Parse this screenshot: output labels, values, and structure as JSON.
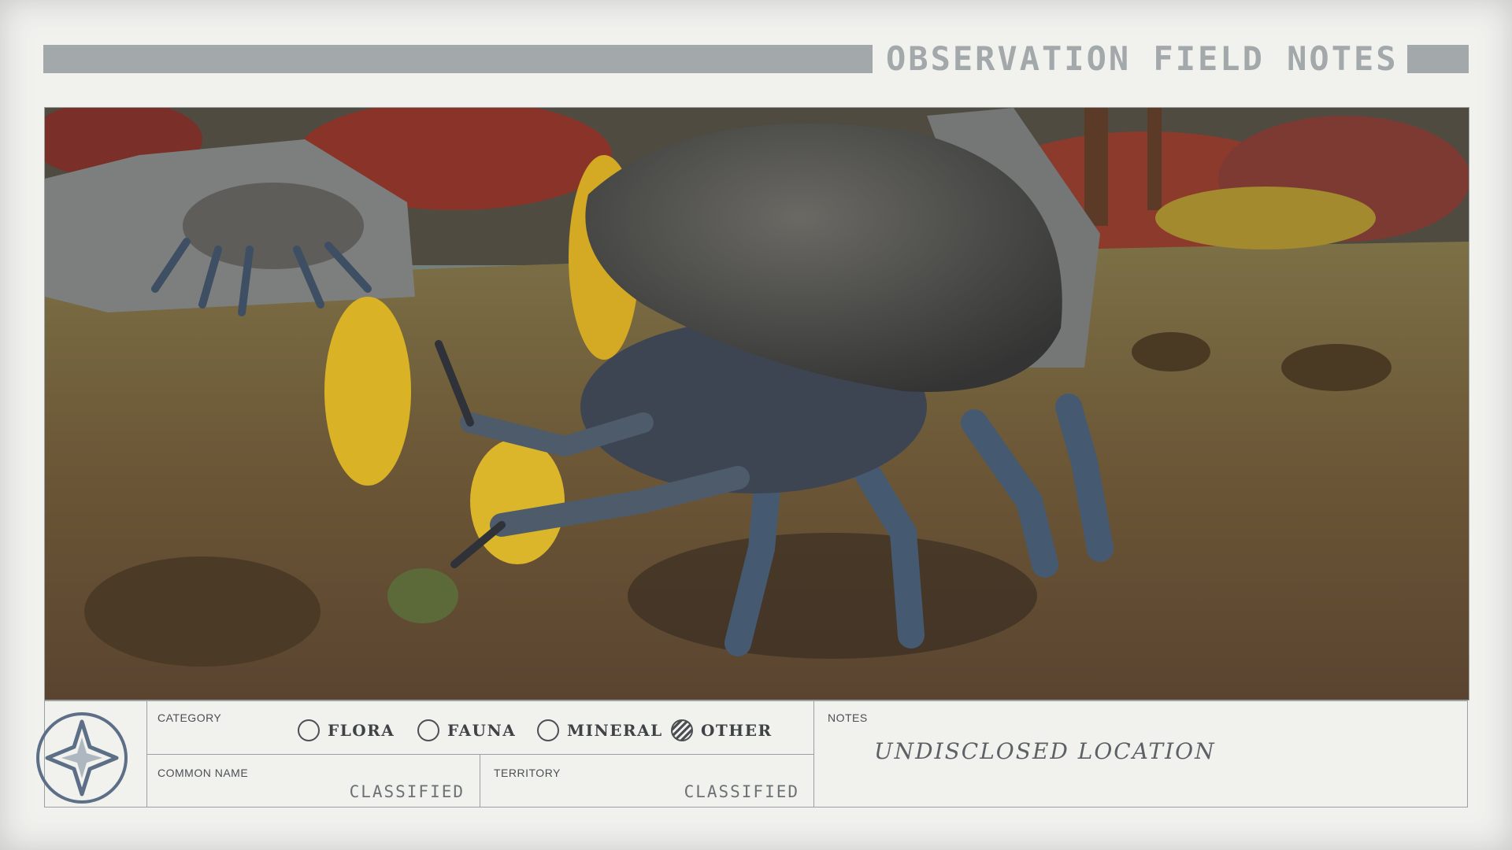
{
  "header": {
    "title": "OBSERVATION FIELD NOTES"
  },
  "photo": {
    "subject-icon": "alien-crab-creature"
  },
  "form": {
    "category_label": "CATEGORY",
    "options": [
      {
        "label": "FLORA",
        "checked": false
      },
      {
        "label": "FAUNA",
        "checked": false
      },
      {
        "label": "MINERAL",
        "checked": false
      },
      {
        "label": "OTHER",
        "checked": true
      }
    ],
    "common_name_label": "COMMON NAME",
    "common_name_value": "CLASSIFIED",
    "territory_label": "TERRITORY",
    "territory_value": "CLASSIFIED",
    "notes_label": "NOTES",
    "notes_value": "UNDISCLOSED LOCATION"
  },
  "colors": {
    "accent": "#a3a8ab",
    "ink": "#4b4f52",
    "paper": "#f1f1ee"
  },
  "icons": {
    "logo": "star-emblem-icon"
  }
}
